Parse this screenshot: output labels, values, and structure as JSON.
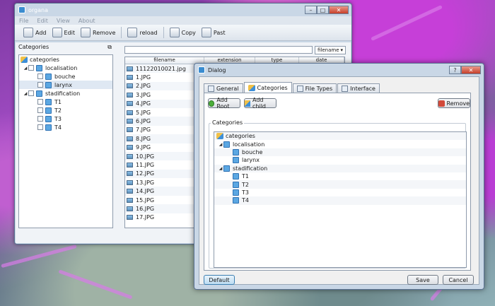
{
  "main_window": {
    "title": "organa",
    "menu": [
      "File",
      "Edit",
      "View",
      "About"
    ],
    "toolbar": {
      "add": "Add",
      "edit": "Edit",
      "remove": "Remove",
      "reload": "reload",
      "copy": "Copy",
      "paste": "Past"
    },
    "categories_panel": {
      "title": "Categories",
      "root": "categories",
      "items": [
        {
          "label": "localisation",
          "level": 1,
          "expanded": true
        },
        {
          "label": "bouche",
          "level": 2
        },
        {
          "label": "larynx",
          "level": 2,
          "selected": true
        },
        {
          "label": "stadification",
          "level": 1,
          "expanded": true
        },
        {
          "label": "T1",
          "level": 2
        },
        {
          "label": "T2",
          "level": 2
        },
        {
          "label": "T3",
          "level": 2
        },
        {
          "label": "T4",
          "level": 2
        }
      ]
    },
    "sort_select": "filename",
    "file_list": {
      "columns": [
        "filename",
        "extension",
        "type",
        "date"
      ],
      "files": [
        "11122010021.jpg",
        "1.JPG",
        "2.JPG",
        "3.JPG",
        "4.JPG",
        "5.JPG",
        "6.JPG",
        "7.JPG",
        "8.JPG",
        "9.JPG",
        "10.JPG",
        "11.JPG",
        "12.JPG",
        "13.JPG",
        "14.JPG",
        "15.JPG",
        "16.JPG",
        "17.JPG"
      ]
    }
  },
  "dialog": {
    "title": "Dialog",
    "tabs": [
      "General",
      "Categories",
      "File Types",
      "Interface"
    ],
    "active_tab": "Categories",
    "buttons": {
      "add_root": "Add Root",
      "add_child": "Add child",
      "remove": "Remove",
      "default": "Default",
      "save": "Save",
      "cancel": "Cancel"
    },
    "groupbox_label": "Categories",
    "tree": {
      "root": "categories",
      "items": [
        {
          "label": "localisation",
          "level": 1
        },
        {
          "label": "bouche",
          "level": 2
        },
        {
          "label": "larynx",
          "level": 2
        },
        {
          "label": "stadification",
          "level": 1
        },
        {
          "label": "T1",
          "level": 2
        },
        {
          "label": "T2",
          "level": 2
        },
        {
          "label": "T3",
          "level": 2
        },
        {
          "label": "T4",
          "level": 2
        }
      ]
    }
  }
}
